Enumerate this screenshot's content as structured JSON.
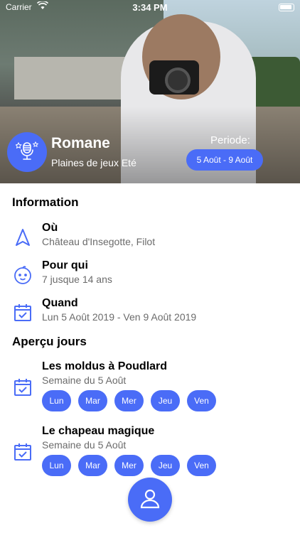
{
  "status_bar": {
    "carrier": "Carrier",
    "time": "3:34 PM"
  },
  "header": {
    "name": "Romane",
    "subtitle": "Plaines de jeux Eté",
    "periode_label": "Periode:",
    "periode_value": "5 Août - 9 Août"
  },
  "information": {
    "title": "Information",
    "rows": [
      {
        "icon": "navigation-arrow-icon",
        "title": "Où",
        "text": "Château d'Insegotte, Filot"
      },
      {
        "icon": "baby-face-icon",
        "title": "Pour qui",
        "text": "7 jusque 14 ans"
      },
      {
        "icon": "calendar-check-icon",
        "title": "Quand",
        "text": "Lun 5 Août 2019 - Ven 9 Août 2019"
      }
    ]
  },
  "apercu": {
    "title": "Aperçu jours",
    "activities": [
      {
        "title": "Les moldus à Poudlard",
        "subtitle": "Semaine du 5 Août",
        "days": [
          "Lun",
          "Mar",
          "Mer",
          "Jeu",
          "Ven"
        ]
      },
      {
        "title": "Le chapeau magique",
        "subtitle": "Semaine du 5 Août",
        "days": [
          "Lun",
          "Mar",
          "Mer",
          "Jeu",
          "Ven"
        ]
      }
    ]
  },
  "colors": {
    "accent": "#4a6cf7"
  }
}
